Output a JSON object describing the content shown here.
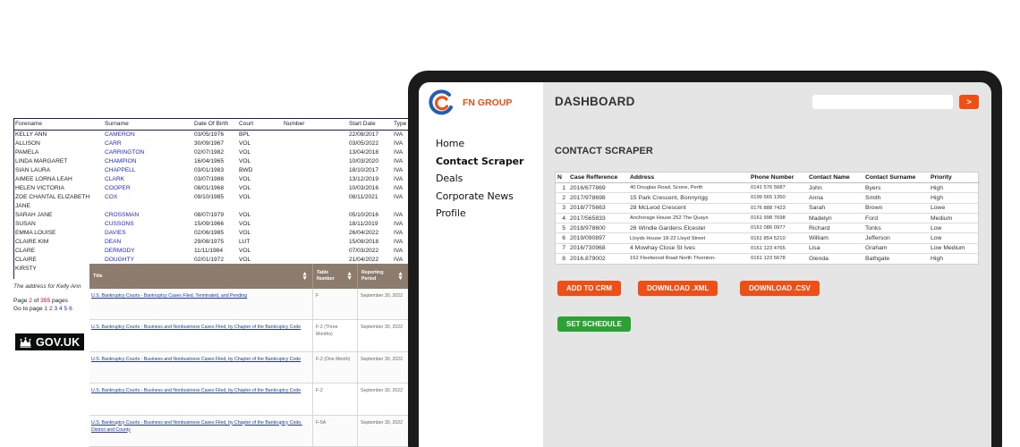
{
  "register": {
    "headers": [
      "Forename",
      "Surname",
      "Date Of Birth",
      "Court",
      "Number",
      "Start Date",
      "Type"
    ],
    "rows": [
      [
        "KELLY ANN",
        "CAMERON",
        "03/05/1976",
        "BPL",
        "",
        "22/08/2017",
        "IVA"
      ],
      [
        "ALLISON",
        "CARR",
        "30/09/1967",
        "VOL",
        "",
        "03/05/2022",
        "IVA"
      ],
      [
        "PAMELA",
        "CARRINGTON",
        "02/07/1982",
        "VOL",
        "",
        "13/04/2018",
        "IVA"
      ],
      [
        "LINDA MARGARET",
        "CHAMPION",
        "16/04/1965",
        "VOL",
        "",
        "10/03/2020",
        "IVA"
      ],
      [
        "SIAN LAURA",
        "CHAPPELL",
        "03/01/1983",
        "BWD",
        "",
        "18/10/2017",
        "IVA"
      ],
      [
        "AIMEE LORNA LEAH",
        "CLARK",
        "03/07/1988",
        "VOL",
        "",
        "13/12/2019",
        "IVA"
      ],
      [
        "HELEN VICTORIA",
        "COOPER",
        "08/01/1968",
        "VOL",
        "",
        "10/03/2016",
        "IVA"
      ],
      [
        "ZOE CHANTAL ELIZABETH JANE",
        "COX",
        "09/10/1985",
        "VOL",
        "",
        "08/11/2021",
        "IVA"
      ],
      [
        "SARAH JANE",
        "CROSSMAN",
        "08/07/1979",
        "VOL",
        "",
        "05/10/2016",
        "IVA"
      ],
      [
        "SUSAN",
        "CUSSONS",
        "15/09/1966",
        "VOL",
        "",
        "18/11/2019",
        "IVA"
      ],
      [
        "EMMA LOUISE",
        "DAVIES",
        "02/06/1985",
        "VOL",
        "",
        "26/04/2022",
        "IVA"
      ],
      [
        "CLAIRE KIM",
        "DEAN",
        "29/08/1975",
        "LUT",
        "",
        "15/08/2018",
        "IVA"
      ],
      [
        "CLARE",
        "DERMODY",
        "11/11/1984",
        "VOL",
        "",
        "07/03/2022",
        "IVA"
      ],
      [
        "CLAIRE",
        "DOUGHTY",
        "02/01/1972",
        "VOL",
        "",
        "21/04/2022",
        "IVA"
      ],
      [
        "KIRSTY",
        "",
        "",
        "",
        "",
        "",
        ""
      ]
    ],
    "note": "The address for Kelly Ann",
    "pages": {
      "prefix": "Page",
      "current": "2",
      "of_label": "of",
      "total": "355",
      "suffix": "pages",
      "goto": "Go to page",
      "links": [
        "1",
        "2",
        "3",
        "4",
        "5",
        "6"
      ]
    },
    "govuk_label": "GOV.UK"
  },
  "bankruptcy": {
    "headers": [
      "Title",
      "Table Number",
      "Reporting Period"
    ],
    "rows": [
      [
        "U.S. Bankruptcy Courts - Bankruptcy Cases Filed, Terminated, and Pending",
        "F",
        "September 30, 2022"
      ],
      [
        "U.S. Bankruptcy Courts - Business and Nonbusiness Cases Filed, by Chapter of the Bankruptcy Code",
        "F-2 (Three Months)",
        "September 30, 2022"
      ],
      [
        "U.S. Bankruptcy Courts - Business and Nonbusiness Cases Filed, by Chapter of the Bankruptcy Code",
        "F-2 (One Month)",
        "September 30, 2022"
      ],
      [
        "U.S. Bankruptcy Courts - Business and Nonbusiness Cases Filed, by Chapter of the Bankruptcy Code",
        "F-2",
        "September 30, 2022"
      ],
      [
        "U.S. Bankruptcy Courts - Business and Nonbusiness Cases Filed, by Chapter of the Bankruptcy Code, District and County",
        "F-5A",
        "September 30, 2022"
      ]
    ]
  },
  "app": {
    "brand": "FN GROUP",
    "nav": [
      "Home",
      "Contact Scraper",
      "Deals",
      "Corporate News",
      "Profile"
    ],
    "active_nav": "Contact Scraper",
    "title": "DASHBOARD",
    "search_value": "",
    "go_label": ">",
    "section": "CONTACT SCRAPER",
    "table": {
      "headers": [
        "N",
        "Case Refference",
        "Address",
        "Phone Number",
        "Contact Name",
        "Contact Surname",
        "Priority"
      ],
      "rows": [
        [
          "1",
          "2016/677869",
          "40 Douglas Road, Scone, Perth",
          "0141 576 5687",
          "John",
          "Byers",
          "High"
        ],
        [
          "2",
          "2017/978698",
          "15 Park Crescent, Bonnyrigg",
          "0199 565 1350",
          "Anna",
          "Smith",
          "High"
        ],
        [
          "3",
          "2018/775663",
          "28 McLeod Crescent",
          "0176 888 7423",
          "Sarah",
          "Brown",
          "Lowe"
        ],
        [
          "4",
          "2017/565833",
          "Anchorage House 252 The Quays",
          "0161 998 7698",
          "Madelyn",
          "Ford",
          "Medium"
        ],
        [
          "5",
          "2018/978600",
          "26 Windle Gardens Elcester",
          "0161 086 0977",
          "Richard",
          "Tonks",
          "Low"
        ],
        [
          "6",
          "2019/090897",
          "Lloyds House 18-22 Lloyd Street",
          "0161 854 5210",
          "William",
          "Jefferson",
          "Low"
        ],
        [
          "7",
          "2016/730968",
          "4 Mowhay Close St Ives",
          "0161 123 4765",
          "Lisa",
          "Graham",
          "Low Medium"
        ],
        [
          "8",
          "2016.879002",
          "162 Fleetwood Road North Thornton-",
          "0161 123 5678",
          "Glenda",
          "Bathgate",
          "High"
        ]
      ]
    },
    "buttons": {
      "add_crm": "ADD TO CRM",
      "download_xml": "DOWNLOAD .XML",
      "download_csv": "DOWNLOAD .CSV",
      "set_schedule": "SET SCHEDULE"
    },
    "colors": {
      "accent": "#ee4f14",
      "success": "#2aa334",
      "logo_blue": "#1f5fb0",
      "device": "#1b1b1b"
    }
  }
}
